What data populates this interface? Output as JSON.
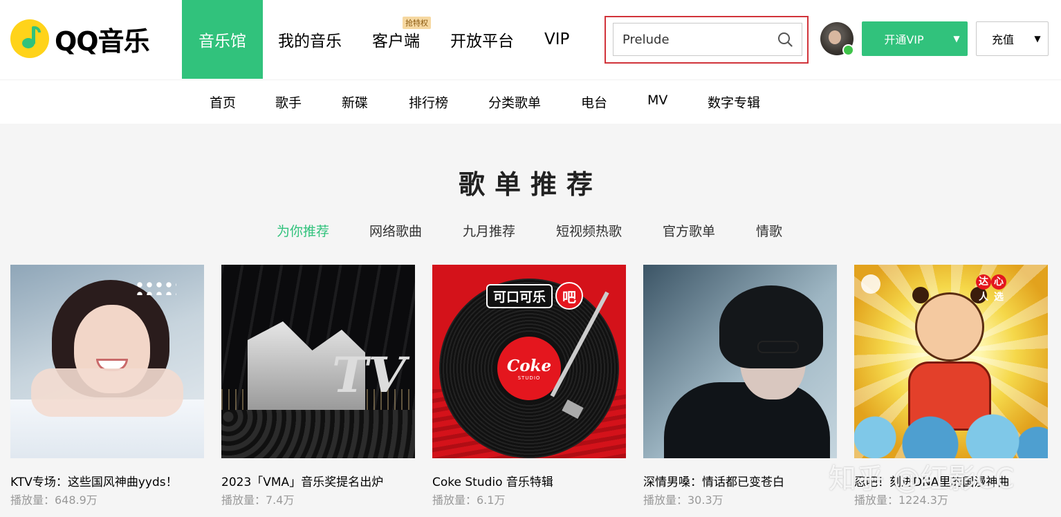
{
  "header": {
    "logo_text": "QQ音乐",
    "main_nav": [
      {
        "label": "音乐馆",
        "active": true
      },
      {
        "label": "我的音乐"
      },
      {
        "label": "客户端",
        "badge": "抢特权"
      },
      {
        "label": "开放平台"
      },
      {
        "label": "VIP"
      }
    ],
    "search": {
      "value": "Prelude",
      "placeholder": "",
      "icon": "search-icon"
    },
    "avatar_icon": "wechat-icon",
    "vip_button": "开通VIP",
    "recharge_button": "充值",
    "accent_color": "#31c27c",
    "highlight_color": "#d1333a"
  },
  "subnav": [
    "首页",
    "歌手",
    "新碟",
    "排行榜",
    "分类歌单",
    "电台",
    "MV",
    "数字专辑"
  ],
  "section": {
    "title": "歌单推荐",
    "tabs": [
      {
        "label": "为你推荐",
        "active": true
      },
      {
        "label": "网络歌曲"
      },
      {
        "label": "九月推荐"
      },
      {
        "label": "短视频热歌"
      },
      {
        "label": "官方歌单"
      },
      {
        "label": "情歌"
      }
    ]
  },
  "playlists": [
    {
      "title": "KTV专场：这些国风神曲yyds！",
      "plays": "播放量：648.9万"
    },
    {
      "title": "2023「VMA」音乐奖提名出炉",
      "plays": "播放量：7.4万",
      "cover_text": "TV"
    },
    {
      "title": "Coke Studio 音乐特辑",
      "plays": "播放量：6.1万",
      "cover_brand": "可口可乐",
      "cover_brand_char": "吧",
      "cover_logo": "Coke",
      "cover_logo_sub": "STUDIO"
    },
    {
      "title": "深情男嗓：情话都已变苍白",
      "plays": "播放量：30.3万"
    },
    {
      "title": "忍吧！刻进DNA里的国漫神曲",
      "plays": "播放量：1224.3万",
      "cover_tag": "达人",
      "cover_tag_char": "心选"
    }
  ],
  "watermark": "知乎 @红影CC"
}
